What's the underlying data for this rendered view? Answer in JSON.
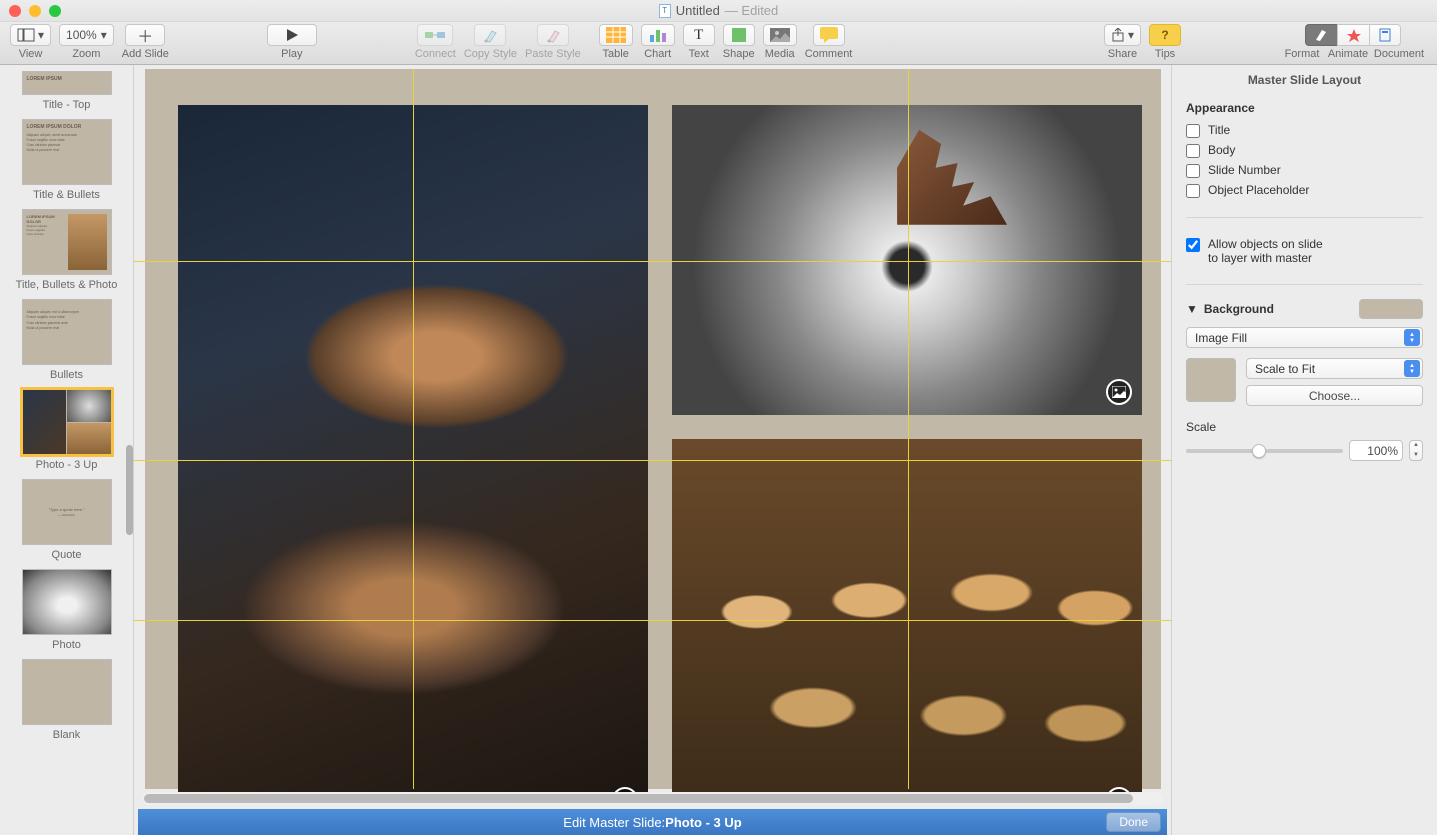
{
  "window": {
    "title": "Untitled",
    "suffix": "— Edited"
  },
  "toolbar": {
    "view": "View",
    "zoom": "Zoom",
    "zoom_value": "100%",
    "add_slide": "Add Slide",
    "play": "Play",
    "connect": "Connect",
    "copy_style": "Copy Style",
    "paste_style": "Paste Style",
    "table": "Table",
    "chart": "Chart",
    "text": "Text",
    "shape": "Shape",
    "media": "Media",
    "comment": "Comment",
    "share": "Share",
    "tips": "Tips",
    "format": "Format",
    "animate": "Animate",
    "document": "Document"
  },
  "navigator": [
    {
      "key": "title_top",
      "label": "Title - Top"
    },
    {
      "key": "title_bullets",
      "label": "Title & Bullets"
    },
    {
      "key": "title_bullets_photo",
      "label": "Title, Bullets & Photo"
    },
    {
      "key": "bullets",
      "label": "Bullets"
    },
    {
      "key": "photo_3up",
      "label": "Photo - 3 Up",
      "selected": true
    },
    {
      "key": "quote",
      "label": "Quote"
    },
    {
      "key": "photo",
      "label": "Photo"
    },
    {
      "key": "blank",
      "label": "Blank"
    }
  ],
  "editbar": {
    "prefix": "Edit Master Slide: ",
    "name": "Photo - 3 Up",
    "done": "Done"
  },
  "inspector": {
    "title": "Master Slide Layout",
    "appearance": "Appearance",
    "chk_title": "Title",
    "chk_body": "Body",
    "chk_slide_number": "Slide Number",
    "chk_object_placeholder": "Object Placeholder",
    "allow_layer_l1": "Allow objects on slide",
    "allow_layer_l2": "to layer with master",
    "background": "Background",
    "fill_type": "Image Fill",
    "scale_mode": "Scale to Fit",
    "choose": "Choose...",
    "scale": "Scale",
    "scale_value": "100%"
  }
}
